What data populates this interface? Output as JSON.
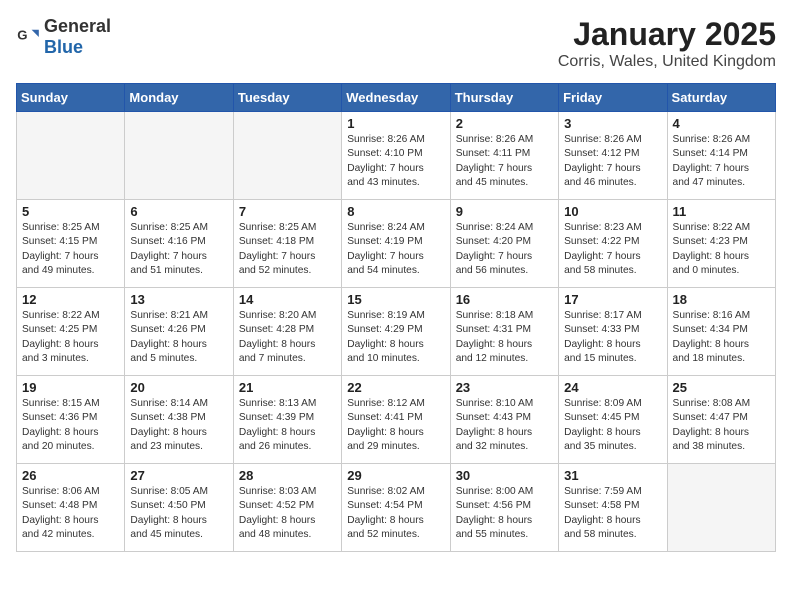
{
  "header": {
    "logo_general": "General",
    "logo_blue": "Blue",
    "title": "January 2025",
    "subtitle": "Corris, Wales, United Kingdom"
  },
  "days_of_week": [
    "Sunday",
    "Monday",
    "Tuesday",
    "Wednesday",
    "Thursday",
    "Friday",
    "Saturday"
  ],
  "weeks": [
    [
      {
        "day": "",
        "info": ""
      },
      {
        "day": "",
        "info": ""
      },
      {
        "day": "",
        "info": ""
      },
      {
        "day": "1",
        "info": "Sunrise: 8:26 AM\nSunset: 4:10 PM\nDaylight: 7 hours\nand 43 minutes."
      },
      {
        "day": "2",
        "info": "Sunrise: 8:26 AM\nSunset: 4:11 PM\nDaylight: 7 hours\nand 45 minutes."
      },
      {
        "day": "3",
        "info": "Sunrise: 8:26 AM\nSunset: 4:12 PM\nDaylight: 7 hours\nand 46 minutes."
      },
      {
        "day": "4",
        "info": "Sunrise: 8:26 AM\nSunset: 4:14 PM\nDaylight: 7 hours\nand 47 minutes."
      }
    ],
    [
      {
        "day": "5",
        "info": "Sunrise: 8:25 AM\nSunset: 4:15 PM\nDaylight: 7 hours\nand 49 minutes."
      },
      {
        "day": "6",
        "info": "Sunrise: 8:25 AM\nSunset: 4:16 PM\nDaylight: 7 hours\nand 51 minutes."
      },
      {
        "day": "7",
        "info": "Sunrise: 8:25 AM\nSunset: 4:18 PM\nDaylight: 7 hours\nand 52 minutes."
      },
      {
        "day": "8",
        "info": "Sunrise: 8:24 AM\nSunset: 4:19 PM\nDaylight: 7 hours\nand 54 minutes."
      },
      {
        "day": "9",
        "info": "Sunrise: 8:24 AM\nSunset: 4:20 PM\nDaylight: 7 hours\nand 56 minutes."
      },
      {
        "day": "10",
        "info": "Sunrise: 8:23 AM\nSunset: 4:22 PM\nDaylight: 7 hours\nand 58 minutes."
      },
      {
        "day": "11",
        "info": "Sunrise: 8:22 AM\nSunset: 4:23 PM\nDaylight: 8 hours\nand 0 minutes."
      }
    ],
    [
      {
        "day": "12",
        "info": "Sunrise: 8:22 AM\nSunset: 4:25 PM\nDaylight: 8 hours\nand 3 minutes."
      },
      {
        "day": "13",
        "info": "Sunrise: 8:21 AM\nSunset: 4:26 PM\nDaylight: 8 hours\nand 5 minutes."
      },
      {
        "day": "14",
        "info": "Sunrise: 8:20 AM\nSunset: 4:28 PM\nDaylight: 8 hours\nand 7 minutes."
      },
      {
        "day": "15",
        "info": "Sunrise: 8:19 AM\nSunset: 4:29 PM\nDaylight: 8 hours\nand 10 minutes."
      },
      {
        "day": "16",
        "info": "Sunrise: 8:18 AM\nSunset: 4:31 PM\nDaylight: 8 hours\nand 12 minutes."
      },
      {
        "day": "17",
        "info": "Sunrise: 8:17 AM\nSunset: 4:33 PM\nDaylight: 8 hours\nand 15 minutes."
      },
      {
        "day": "18",
        "info": "Sunrise: 8:16 AM\nSunset: 4:34 PM\nDaylight: 8 hours\nand 18 minutes."
      }
    ],
    [
      {
        "day": "19",
        "info": "Sunrise: 8:15 AM\nSunset: 4:36 PM\nDaylight: 8 hours\nand 20 minutes."
      },
      {
        "day": "20",
        "info": "Sunrise: 8:14 AM\nSunset: 4:38 PM\nDaylight: 8 hours\nand 23 minutes."
      },
      {
        "day": "21",
        "info": "Sunrise: 8:13 AM\nSunset: 4:39 PM\nDaylight: 8 hours\nand 26 minutes."
      },
      {
        "day": "22",
        "info": "Sunrise: 8:12 AM\nSunset: 4:41 PM\nDaylight: 8 hours\nand 29 minutes."
      },
      {
        "day": "23",
        "info": "Sunrise: 8:10 AM\nSunset: 4:43 PM\nDaylight: 8 hours\nand 32 minutes."
      },
      {
        "day": "24",
        "info": "Sunrise: 8:09 AM\nSunset: 4:45 PM\nDaylight: 8 hours\nand 35 minutes."
      },
      {
        "day": "25",
        "info": "Sunrise: 8:08 AM\nSunset: 4:47 PM\nDaylight: 8 hours\nand 38 minutes."
      }
    ],
    [
      {
        "day": "26",
        "info": "Sunrise: 8:06 AM\nSunset: 4:48 PM\nDaylight: 8 hours\nand 42 minutes."
      },
      {
        "day": "27",
        "info": "Sunrise: 8:05 AM\nSunset: 4:50 PM\nDaylight: 8 hours\nand 45 minutes."
      },
      {
        "day": "28",
        "info": "Sunrise: 8:03 AM\nSunset: 4:52 PM\nDaylight: 8 hours\nand 48 minutes."
      },
      {
        "day": "29",
        "info": "Sunrise: 8:02 AM\nSunset: 4:54 PM\nDaylight: 8 hours\nand 52 minutes."
      },
      {
        "day": "30",
        "info": "Sunrise: 8:00 AM\nSunset: 4:56 PM\nDaylight: 8 hours\nand 55 minutes."
      },
      {
        "day": "31",
        "info": "Sunrise: 7:59 AM\nSunset: 4:58 PM\nDaylight: 8 hours\nand 58 minutes."
      },
      {
        "day": "",
        "info": ""
      }
    ]
  ]
}
